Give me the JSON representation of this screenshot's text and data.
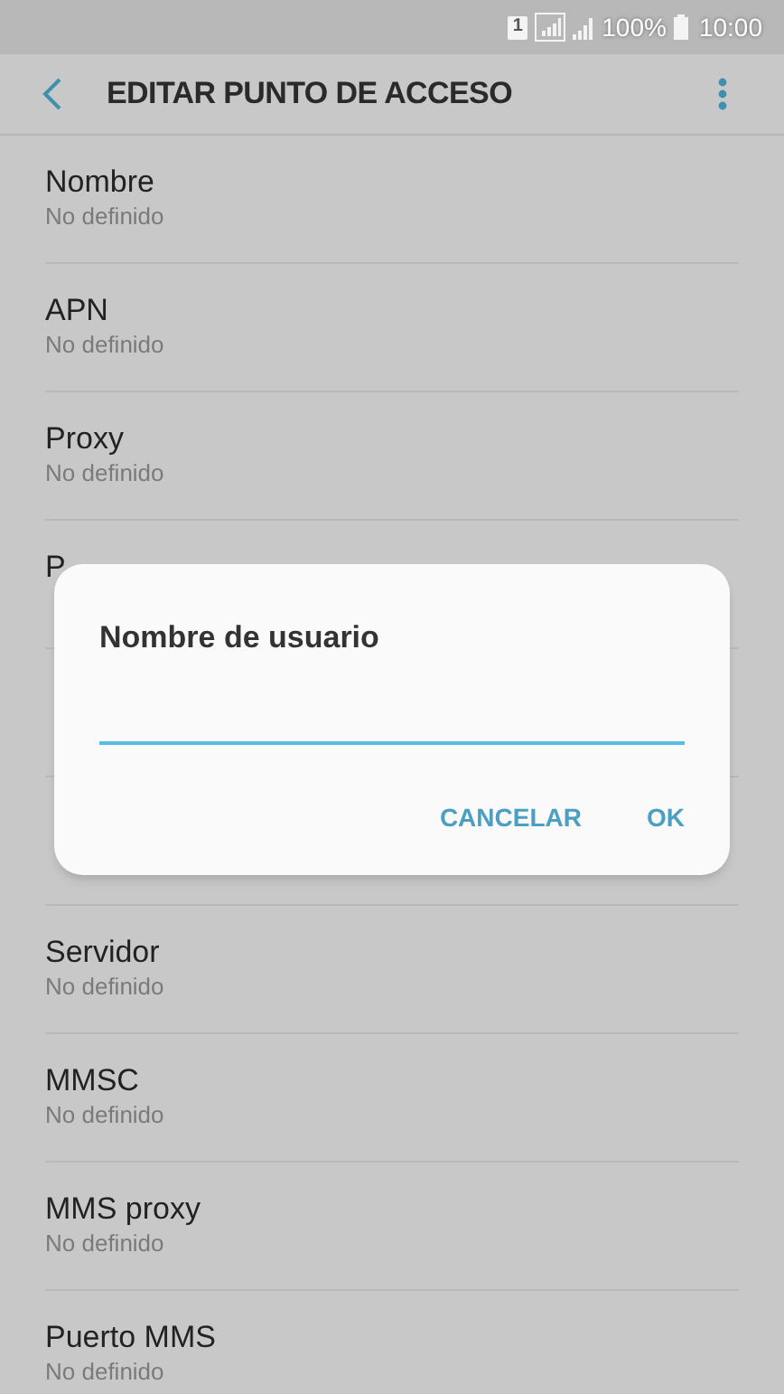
{
  "status_bar": {
    "sim": "1",
    "battery": "100%",
    "time": "10:00"
  },
  "toolbar": {
    "title": "EDITAR PUNTO DE ACCESO"
  },
  "settings": [
    {
      "title": "Nombre",
      "value": "No definido"
    },
    {
      "title": "APN",
      "value": "No definido"
    },
    {
      "title": "Proxy",
      "value": "No definido"
    },
    {
      "kind": "text",
      "title": "P"
    },
    {
      "kind": "covered"
    },
    {
      "kind": "covered"
    },
    {
      "title": "Servidor",
      "value": "No definido"
    },
    {
      "title": "MMSC",
      "value": "No definido"
    },
    {
      "title": "MMS proxy",
      "value": "No definido"
    },
    {
      "title": "Puerto MMS",
      "value": "No definido"
    }
  ],
  "dialog": {
    "title": "Nombre de usuario",
    "buttons": [
      "CANCELAR",
      "OK"
    ]
  }
}
